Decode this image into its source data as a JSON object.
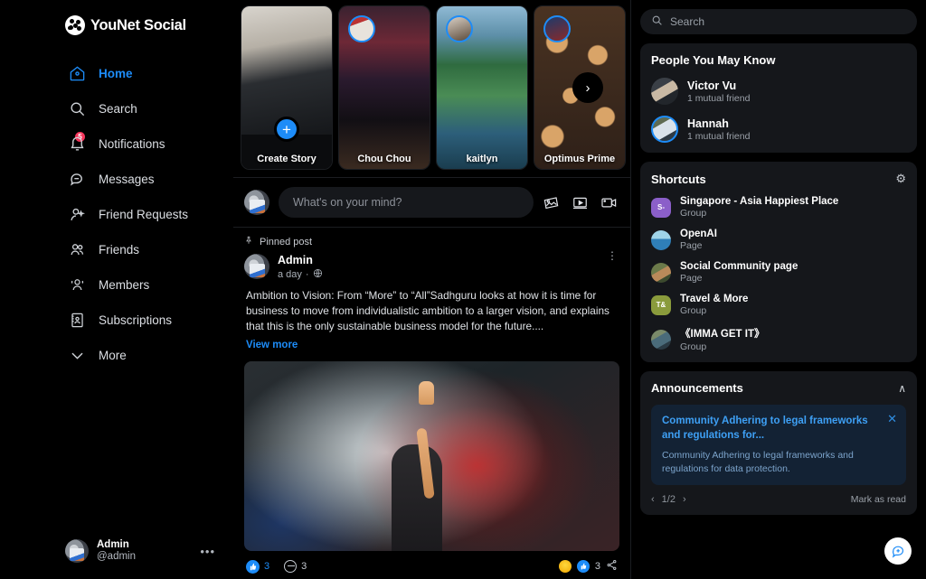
{
  "brand": {
    "name": "YouNet Social",
    "logo_icon": "younet-logo-icon"
  },
  "sidebar": {
    "items": [
      {
        "label": "Home",
        "icon": "home-icon",
        "active": true,
        "badge": null
      },
      {
        "label": "Search",
        "icon": "search-icon",
        "active": false,
        "badge": null
      },
      {
        "label": "Notifications",
        "icon": "bell-icon",
        "active": false,
        "badge": "5"
      },
      {
        "label": "Messages",
        "icon": "message-bubble-icon",
        "active": false,
        "badge": null
      },
      {
        "label": "Friend Requests",
        "icon": "person-add-icon",
        "active": false,
        "badge": null
      },
      {
        "label": "Friends",
        "icon": "people-icon",
        "active": false,
        "badge": null
      },
      {
        "label": "Members",
        "icon": "members-group-icon",
        "active": false,
        "badge": null
      },
      {
        "label": "Subscriptions",
        "icon": "id-card-icon",
        "active": false,
        "badge": null
      },
      {
        "label": "More",
        "icon": "chevron-down-icon",
        "active": false,
        "badge": null
      }
    ],
    "profile": {
      "name": "Admin",
      "handle": "@admin",
      "menu_icon": "more-horizontal-icon",
      "menu_label": "•••"
    }
  },
  "stories": {
    "create": {
      "label": "Create Story",
      "plus_label": "+",
      "plus_icon": "plus-icon"
    },
    "items": [
      {
        "label": "Chou Chou"
      },
      {
        "label": "kaitlyn"
      },
      {
        "label": "Optimus Prime"
      }
    ],
    "next_label": "›",
    "next_icon": "chevron-right-icon"
  },
  "composer": {
    "placeholder": "What's on your mind?",
    "icons": [
      {
        "name": "photo-icon"
      },
      {
        "name": "video-icon"
      },
      {
        "name": "live-video-icon"
      }
    ]
  },
  "post": {
    "pinned_label": "Pinned post",
    "pin_icon": "pin-icon",
    "author": "Admin",
    "time": "a day",
    "separator": "·",
    "privacy_icon": "globe-icon",
    "menu_icon": "more-vertical-icon",
    "menu_label": "⋮",
    "text": "Ambition to Vision: From “More” to “All”Sadhguru looks at how it is time for business to move from individualistic ambition to a larger vision, and explains that this is the only sustainable business model for the future....",
    "view_more": "View more",
    "like_count": "3",
    "comment_count": "3",
    "reaction_count": "3",
    "like_icon": "thumbs-up-icon",
    "comment_icon": "comment-icon",
    "share_icon": "share-icon",
    "reaction_icons": [
      "haha-reaction-icon",
      "like-reaction-icon"
    ],
    "thumb_glyph": "👍"
  },
  "search": {
    "placeholder": "Search",
    "icon": "search-icon"
  },
  "people_you_may_know": {
    "title": "People You May Know",
    "items": [
      {
        "name": "Victor Vu",
        "sub": "1 mutual friend",
        "ring": false
      },
      {
        "name": "Hannah",
        "sub": "1 mutual friend",
        "ring": true
      }
    ]
  },
  "shortcuts": {
    "title": "Shortcuts",
    "settings_icon": "gear-icon",
    "settings_glyph": "⚙",
    "items": [
      {
        "name": "Singapore - Asia Happiest Place",
        "type": "Group",
        "initials": "S-",
        "color": "#8b5fc9",
        "image": false
      },
      {
        "name": "OpenAI",
        "type": "Page",
        "initials": "",
        "color": "#2f7fb8",
        "image": true
      },
      {
        "name": "Social Community page",
        "type": "Page",
        "initials": "",
        "color": "#6b7a4a",
        "image": true
      },
      {
        "name": "Travel & More",
        "type": "Group",
        "initials": "T&",
        "color": "#8a9b3c",
        "image": false
      },
      {
        "name": "《IMMA GET IT》",
        "type": "Group",
        "initials": "",
        "color": "#4a6b7a",
        "image": true
      }
    ]
  },
  "announcements": {
    "title": "Announcements",
    "collapse_icon": "chevron-up-icon",
    "collapse_glyph": "∧",
    "close_glyph": "✕",
    "close_icon": "close-icon",
    "item": {
      "title": "Community Adhering to legal frameworks and regulations for...",
      "desc": "Community Adhering to legal frameworks and regulations for data protection."
    },
    "page_prev": "‹",
    "page_indicator": "1/2",
    "page_next": "›",
    "mark_as_read": "Mark as read"
  },
  "fab": {
    "icon": "new-message-icon"
  },
  "colors": {
    "accent": "#1d8cf8",
    "badge_red": "#f5365c",
    "bg": "#000000",
    "card_bg": "#15171b",
    "announcement_bg": "#132234"
  }
}
